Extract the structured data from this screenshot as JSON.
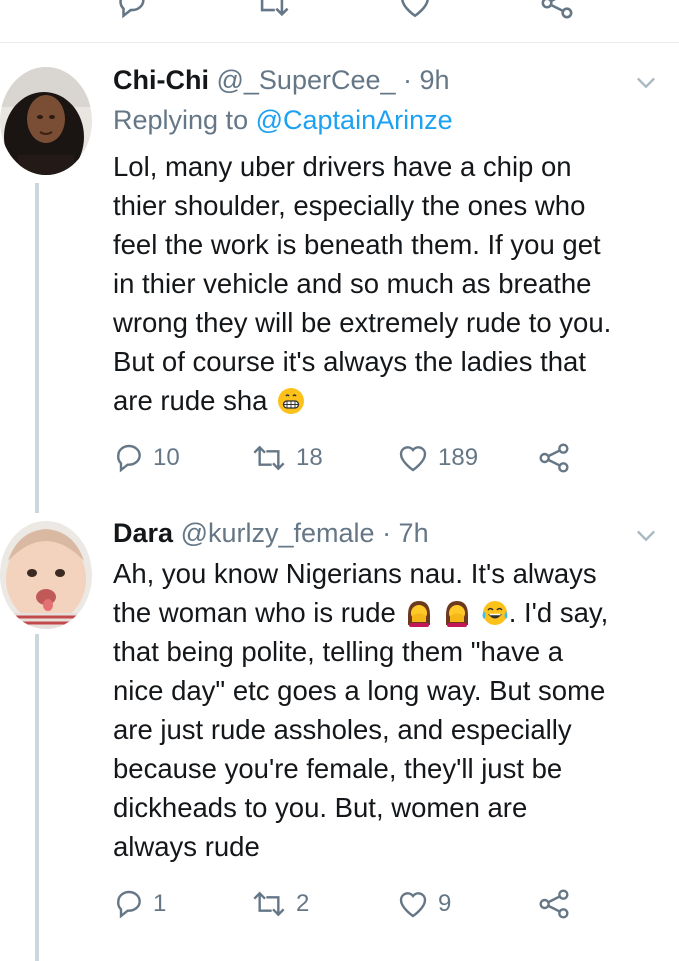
{
  "tweets": [
    {
      "name": "Chi-Chi",
      "handle": "@_SuperCee_",
      "time": "· 9h",
      "replying_prefix": "Replying to",
      "replying_to": "@CaptainArinze",
      "text_lines": [
        "Lol, many uber drivers have a chip on",
        "thier shoulder, especially the ones who",
        "feel the work is beneath them. If you get",
        "in thier vehicle and so much as breathe",
        "wrong they will be extremely rude to you.",
        "But of course it's always the ladies that",
        "are rude sha"
      ],
      "emoji": "grinning-face-emoji",
      "replies": "10",
      "retweets": "18",
      "likes": "189"
    },
    {
      "name": "Dara",
      "handle": "@kurlzy_female",
      "time": "· 7h",
      "text_lines": [
        "Ah, you know Nigerians nau. It's always",
        "the woman who is rude",
        "that being polite, telling them \"have a",
        "nice day\" etc goes a long way. But some",
        "are just rude assholes, and especially",
        "because you're female, they'll just be",
        "dickheads to you. But, women are",
        "always rude"
      ],
      "line2_tail": ". I'd say,",
      "emojis": [
        "woman-facepalming-emoji",
        "woman-facepalming-emoji",
        "face-with-tears-of-joy-emoji"
      ],
      "replies": "1",
      "retweets": "2",
      "likes": "9"
    }
  ],
  "colors": {
    "text": "#14171a",
    "muted": "#657786",
    "link": "#1da1f2",
    "line": "#ccd6dd"
  }
}
